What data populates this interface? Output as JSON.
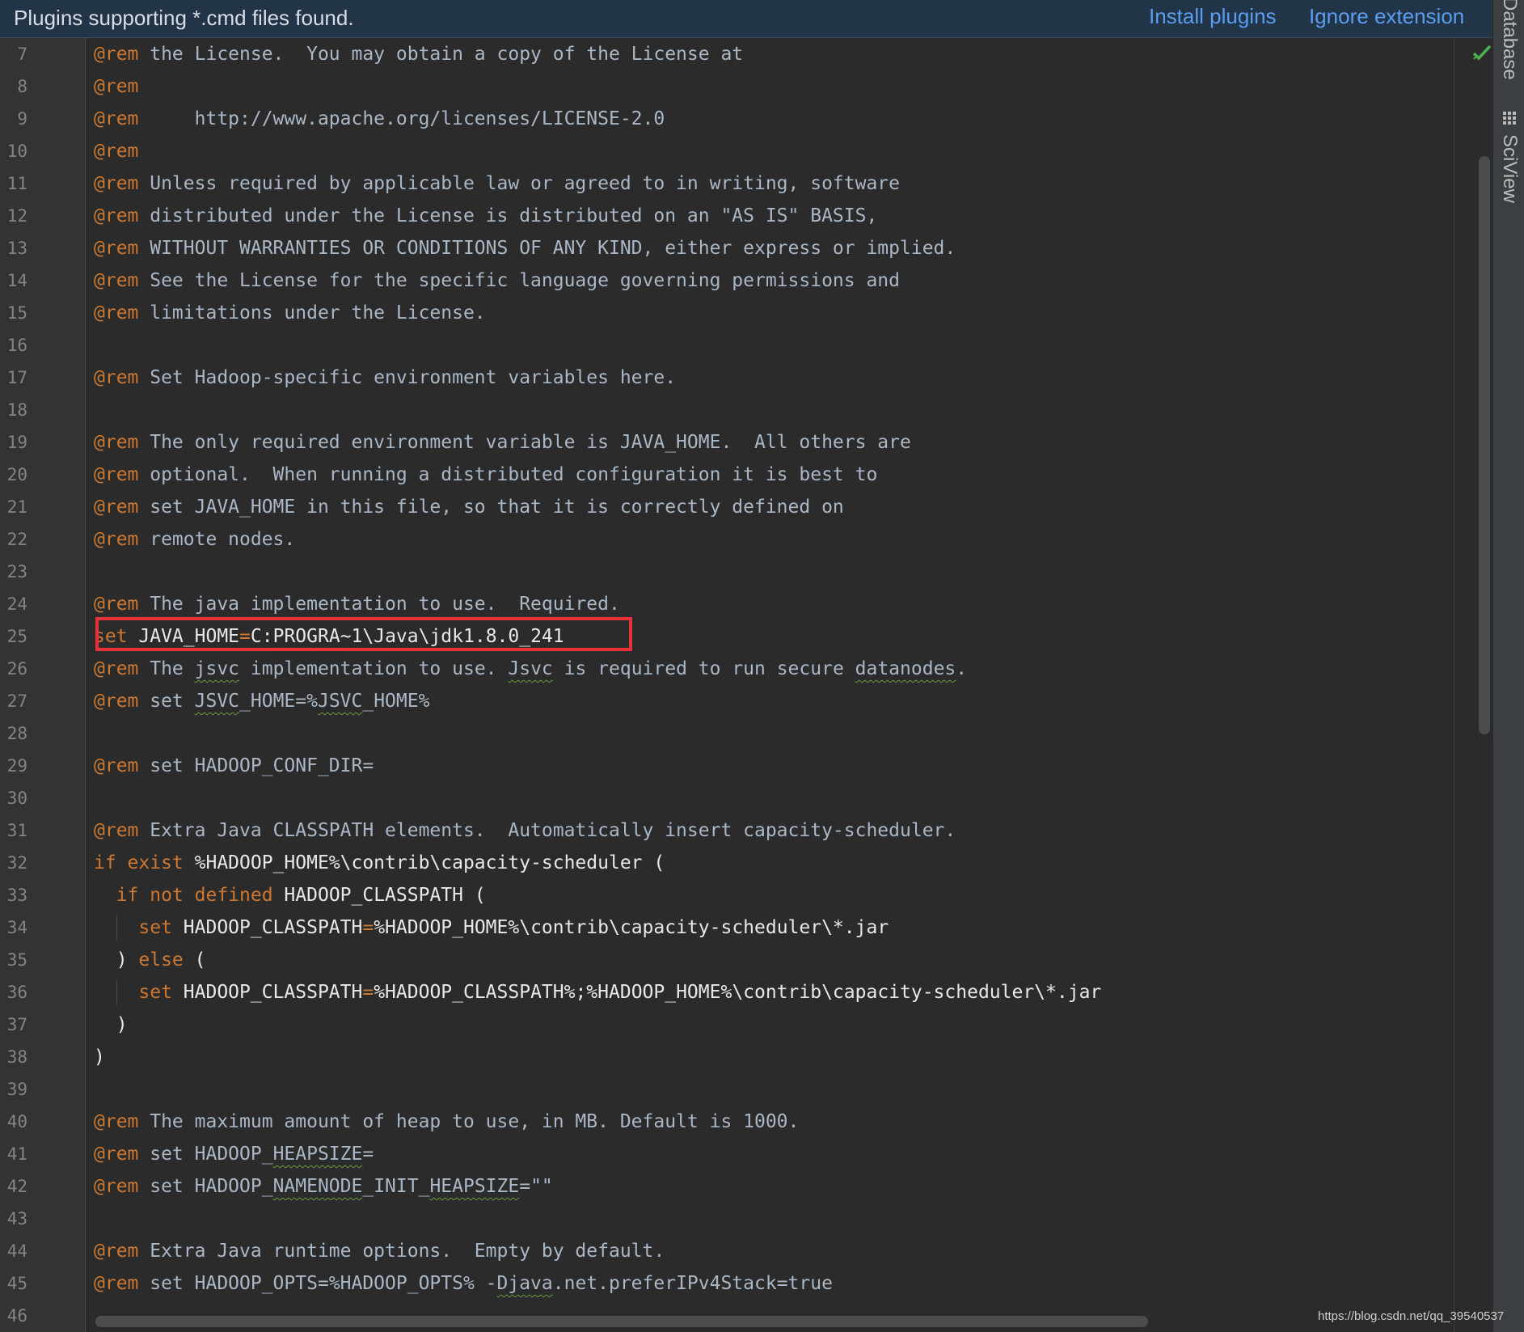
{
  "banner": {
    "message": "Plugins supporting *.cmd files found.",
    "install_label": "Install plugins",
    "ignore_label": "Ignore extension"
  },
  "tool_strip": {
    "database_label": "Database",
    "sciview_label": "SciView"
  },
  "lines": [
    {
      "n": "7",
      "parts": [
        [
          "@rem",
          "kw"
        ],
        [
          " the License.  You may obtain a copy of the License at",
          "cm"
        ]
      ]
    },
    {
      "n": "8",
      "parts": [
        [
          "@rem",
          "kw"
        ]
      ]
    },
    {
      "n": "9",
      "parts": [
        [
          "@rem",
          "kw"
        ],
        [
          "     http://www.apache.org/licenses/LICENSE-2.0",
          "cm"
        ]
      ]
    },
    {
      "n": "10",
      "parts": [
        [
          "@rem",
          "kw"
        ]
      ]
    },
    {
      "n": "11",
      "parts": [
        [
          "@rem",
          "kw"
        ],
        [
          " Unless required by applicable law or agreed to in writing, software",
          "cm"
        ]
      ]
    },
    {
      "n": "12",
      "parts": [
        [
          "@rem",
          "kw"
        ],
        [
          " distributed under the License is distributed on an \"AS IS\" BASIS,",
          "cm"
        ]
      ]
    },
    {
      "n": "13",
      "parts": [
        [
          "@rem",
          "kw"
        ],
        [
          " WITHOUT WARRANTIES OR CONDITIONS OF ANY KIND, either express or implied.",
          "cm"
        ]
      ]
    },
    {
      "n": "14",
      "parts": [
        [
          "@rem",
          "kw"
        ],
        [
          " See the License for the specific language governing permissions and",
          "cm"
        ]
      ]
    },
    {
      "n": "15",
      "parts": [
        [
          "@rem",
          "kw"
        ],
        [
          " limitations under the License.",
          "cm"
        ]
      ]
    },
    {
      "n": "16",
      "parts": []
    },
    {
      "n": "17",
      "parts": [
        [
          "@rem",
          "kw"
        ],
        [
          " Set Hadoop-specific environment variables here.",
          "cm"
        ]
      ]
    },
    {
      "n": "18",
      "parts": []
    },
    {
      "n": "19",
      "parts": [
        [
          "@rem",
          "kw"
        ],
        [
          " The only required environment variable is JAVA_HOME.  All others are",
          "cm"
        ]
      ]
    },
    {
      "n": "20",
      "parts": [
        [
          "@rem",
          "kw"
        ],
        [
          " optional.  When running a distributed configuration it is best to",
          "cm"
        ]
      ]
    },
    {
      "n": "21",
      "parts": [
        [
          "@rem",
          "kw"
        ],
        [
          " set JAVA_HOME in this file, so that it is correctly defined on",
          "cm"
        ]
      ]
    },
    {
      "n": "22",
      "parts": [
        [
          "@rem",
          "kw"
        ],
        [
          " remote nodes.",
          "cm"
        ]
      ]
    },
    {
      "n": "23",
      "parts": []
    },
    {
      "n": "24",
      "parts": [
        [
          "@rem",
          "kw"
        ],
        [
          " The java implementation to use.  Required.",
          "cm"
        ]
      ]
    },
    {
      "n": "25",
      "parts": [
        [
          "set",
          "kw"
        ],
        [
          " JAVA_HOME",
          "var"
        ],
        [
          "=",
          "kw"
        ],
        [
          "C:",
          "var"
        ],
        [
          "PROGRA",
          "var squig"
        ],
        [
          "~1\\Java\\jdk1.8.0_241",
          "var"
        ]
      ]
    },
    {
      "n": "26",
      "parts": [
        [
          "@rem",
          "kw"
        ],
        [
          " The ",
          "cm"
        ],
        [
          "jsvc",
          "cm squig"
        ],
        [
          " implementation to use. ",
          "cm"
        ],
        [
          "Jsvc",
          "cm squig"
        ],
        [
          " is required to run secure ",
          "cm"
        ],
        [
          "datanodes",
          "cm squig"
        ],
        [
          ".",
          "cm"
        ]
      ]
    },
    {
      "n": "27",
      "parts": [
        [
          "@rem",
          "kw"
        ],
        [
          " set ",
          "cm"
        ],
        [
          "JSVC",
          "cm squig"
        ],
        [
          "_HOME=%",
          "cm"
        ],
        [
          "JSVC",
          "cm squig"
        ],
        [
          "_HOME%",
          "cm"
        ]
      ]
    },
    {
      "n": "28",
      "parts": []
    },
    {
      "n": "29",
      "parts": [
        [
          "@rem",
          "kw"
        ],
        [
          " set HADOOP_CONF_DIR=",
          "cm"
        ]
      ]
    },
    {
      "n": "30",
      "parts": []
    },
    {
      "n": "31",
      "parts": [
        [
          "@rem",
          "kw"
        ],
        [
          " Extra Java CLASSPATH elements.  Automatically insert capacity-scheduler.",
          "cm"
        ]
      ]
    },
    {
      "n": "32",
      "parts": [
        [
          "if exist",
          "kw"
        ],
        [
          " %HADOOP_HOME%\\contrib\\capacity-scheduler (",
          "var"
        ]
      ]
    },
    {
      "n": "33",
      "parts": [
        [
          "  ",
          "var"
        ],
        [
          "if not defined",
          "kw"
        ],
        [
          " HADOOP_CLASSPATH (",
          "var"
        ]
      ]
    },
    {
      "n": "34",
      "parts": [
        [
          "    ",
          "var"
        ],
        [
          "set",
          "kw"
        ],
        [
          " HADOOP_CLASSPATH",
          "var"
        ],
        [
          "=",
          "kw"
        ],
        [
          "%HADOOP_HOME%\\contrib\\capacity-scheduler\\*.jar",
          "var"
        ]
      ]
    },
    {
      "n": "35",
      "parts": [
        [
          "  ) ",
          "var"
        ],
        [
          "else",
          "kw"
        ],
        [
          " (",
          "var"
        ]
      ]
    },
    {
      "n": "36",
      "parts": [
        [
          "    ",
          "var"
        ],
        [
          "set",
          "kw"
        ],
        [
          " HADOOP_CLASSPATH",
          "var"
        ],
        [
          "=",
          "kw"
        ],
        [
          "%HADOOP_CLASSPATH%;%HADOOP_HOME%\\contrib\\capacity-scheduler\\*.jar",
          "var"
        ]
      ]
    },
    {
      "n": "37",
      "parts": [
        [
          "  )",
          "var"
        ]
      ]
    },
    {
      "n": "38",
      "parts": [
        [
          ")",
          "var"
        ]
      ]
    },
    {
      "n": "39",
      "parts": []
    },
    {
      "n": "40",
      "parts": [
        [
          "@rem",
          "kw"
        ],
        [
          " The maximum amount of heap to use, in MB. Default is 1000.",
          "cm"
        ]
      ]
    },
    {
      "n": "41",
      "parts": [
        [
          "@rem",
          "kw"
        ],
        [
          " set HADOOP_",
          "cm"
        ],
        [
          "HEAPSIZE",
          "cm squig"
        ],
        [
          "=",
          "cm"
        ]
      ]
    },
    {
      "n": "42",
      "parts": [
        [
          "@rem",
          "kw"
        ],
        [
          " set HADOOP_",
          "cm"
        ],
        [
          "NAMENODE",
          "cm squig"
        ],
        [
          "_INIT_",
          "cm"
        ],
        [
          "HEAPSIZE",
          "cm squig"
        ],
        [
          "=\"\"",
          "cm"
        ]
      ]
    },
    {
      "n": "43",
      "parts": []
    },
    {
      "n": "44",
      "parts": [
        [
          "@rem",
          "kw"
        ],
        [
          " Extra Java runtime options.  Empty by default.",
          "cm"
        ]
      ]
    },
    {
      "n": "45",
      "parts": [
        [
          "@rem",
          "kw"
        ],
        [
          " set HADOOP_OPTS=%HADOOP_OPTS% -",
          "cm"
        ],
        [
          "Djava",
          "cm squig"
        ],
        [
          ".net.preferIPv4Stack=true",
          "cm"
        ]
      ]
    },
    {
      "n": "46",
      "parts": []
    }
  ],
  "watermark": "https://blog.csdn.net/qq_39540537",
  "colors": {
    "keyword": "#cc7832",
    "text": "#a9b7c6",
    "highlight_border": "#e8323a",
    "link": "#5a9eef",
    "banner_bg": "#223448"
  }
}
